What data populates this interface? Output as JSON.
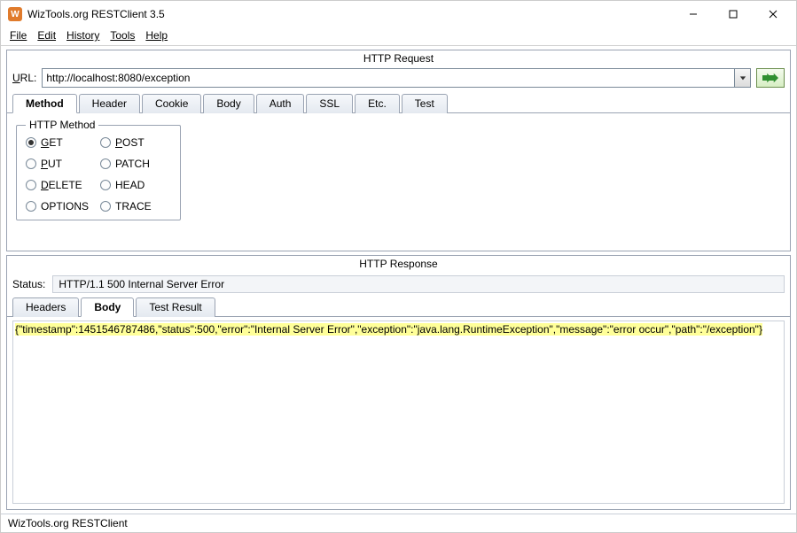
{
  "window": {
    "title": "WizTools.org RESTClient 3.5"
  },
  "menu": {
    "file": "File",
    "edit": "Edit",
    "history": "History",
    "tools": "Tools",
    "help": "Help"
  },
  "request": {
    "panel_title": "HTTP Request",
    "url_label_u": "U",
    "url_label_rest": "RL:",
    "url_value": "http://localhost:8080/exception",
    "tabs": {
      "method": "Method",
      "header": "Header",
      "cookie": "Cookie",
      "body": "Body",
      "auth": "Auth",
      "ssl": "SSL",
      "etc": "Etc.",
      "test": "Test"
    },
    "method_group_label": "HTTP Method",
    "methods": {
      "get_u": "G",
      "get_rest": "ET",
      "post_u": "P",
      "post_rest": "OST",
      "put_u": "P",
      "put_rest": "UT",
      "patch": "PATCH",
      "delete_u": "D",
      "delete_rest": "ELETE",
      "head": "HEAD",
      "options": "OPTIONS",
      "trace": "TRACE"
    },
    "selected_method": "GET"
  },
  "response": {
    "panel_title": "HTTP Response",
    "status_label": "Status:",
    "status_value": "HTTP/1.1 500 Internal Server Error",
    "tabs": {
      "headers": "Headers",
      "body": "Body",
      "test_result": "Test Result"
    },
    "body_text": "{\"timestamp\":1451546787486,\"status\":500,\"error\":\"Internal Server Error\",\"exception\":\"java.lang.RuntimeException\",\"message\":\"error occur\",\"path\":\"/exception\"}"
  },
  "statusbar": {
    "text": "WizTools.org RESTClient"
  }
}
